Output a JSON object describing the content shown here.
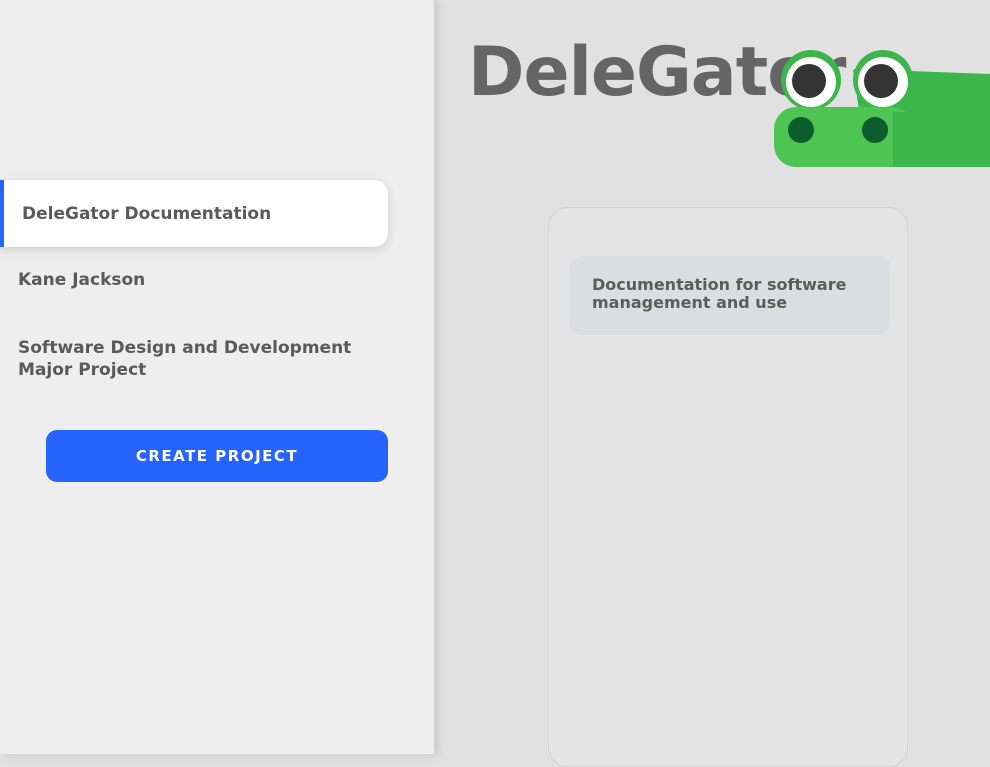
{
  "sidebar": {
    "projects": [
      {
        "label": "DeleGator Documentation",
        "active": true
      },
      {
        "label": "Kane Jackson",
        "active": false
      },
      {
        "label": "Software Design and Development Major Project",
        "active": false
      }
    ],
    "create_button_label": "CREATE PROJECT"
  },
  "header": {
    "logo_text": "DeleGator",
    "mascot_icon": "gator-head-icon"
  },
  "main": {
    "cards": [
      {
        "text": "Documentation for software management and use"
      }
    ]
  },
  "colors": {
    "accent": "#2563fb",
    "logo_text": "#656565",
    "gator_green": "#3cb54a"
  }
}
